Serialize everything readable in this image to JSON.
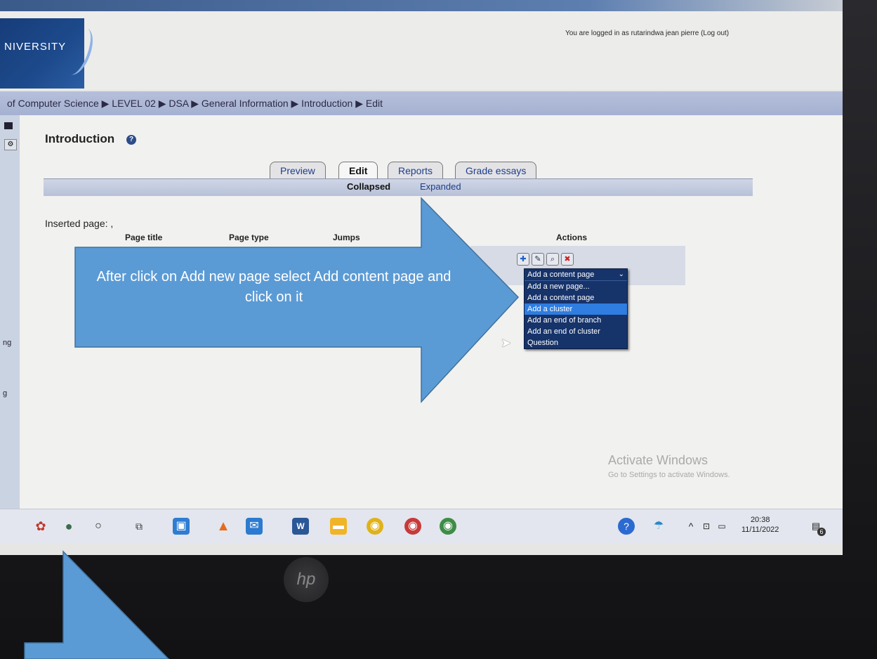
{
  "header": {
    "logo_text": "NIVERSITY",
    "login_info": "You are logged in as rutarindwa jean pierre (Log out)"
  },
  "breadcrumb": "of Computer Science ▶ LEVEL 02 ▶ DSA ▶ General Information ▶ Introduction ▶ Edit",
  "sidebar": {
    "label_a": "ng",
    "label_b": "g"
  },
  "page": {
    "title": "Introduction",
    "tabs": [
      "Preview",
      "Edit",
      "Reports",
      "Grade essays"
    ],
    "subtabs": [
      "Collapsed",
      "Expanded"
    ],
    "inserted_label": "Inserted page: ,",
    "columns": [
      "Page title",
      "Page type",
      "Jumps",
      "Actions"
    ]
  },
  "dropdown": {
    "selected": "Add a content page",
    "options": [
      "Add a new page...",
      "Add a content page",
      "Add a cluster",
      "Add an end of branch",
      "Add an end of cluster",
      "Question"
    ],
    "highlighted": "Add a cluster"
  },
  "callout": {
    "text": "After click on Add new page select Add content page and click on it",
    "color": "#5b9bd5"
  },
  "watermark": {
    "line1": "Activate Windows",
    "line2": "Go to Settings to activate Windows."
  },
  "taskbar": {
    "time": "20:38",
    "date": "11/11/2022",
    "notification_count": "6"
  },
  "bezel_logo": "hp"
}
